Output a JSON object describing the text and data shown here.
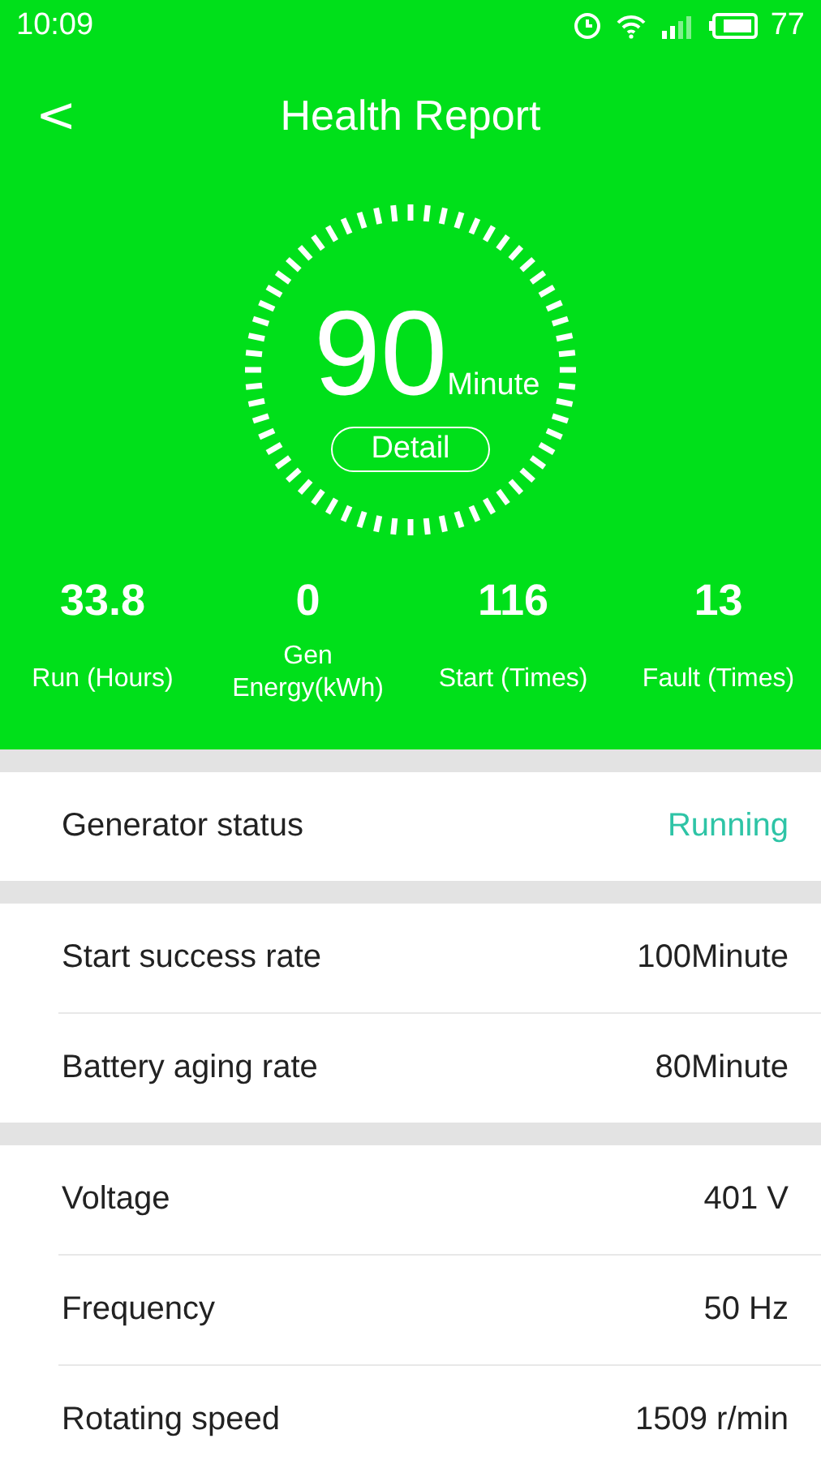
{
  "status_bar": {
    "time": "10:09",
    "battery": "77"
  },
  "header": {
    "back": "<",
    "title": "Health Report"
  },
  "gauge": {
    "value": "90",
    "unit": "Minute",
    "button": "Detail"
  },
  "stats": [
    {
      "value": "33.8",
      "label": "Run (Hours)"
    },
    {
      "value": "0",
      "label": "Gen Energy(kWh)"
    },
    {
      "value": "116",
      "label": "Start (Times)"
    },
    {
      "value": "13",
      "label": "Fault (Times)"
    }
  ],
  "sections": [
    [
      {
        "kind": "status",
        "label": "Generator status",
        "value": "Running"
      }
    ],
    [
      {
        "kind": "plain",
        "label": "Start success rate",
        "value": "100Minute"
      },
      {
        "kind": "plain",
        "label": "Battery aging rate",
        "value": "80Minute"
      }
    ],
    [
      {
        "kind": "plain",
        "label": "Voltage",
        "value": "401 V"
      },
      {
        "kind": "plain",
        "label": "Frequency",
        "value": "50 Hz"
      },
      {
        "kind": "plain",
        "label": "Rotating speed",
        "value": "1509 r/min"
      }
    ]
  ]
}
